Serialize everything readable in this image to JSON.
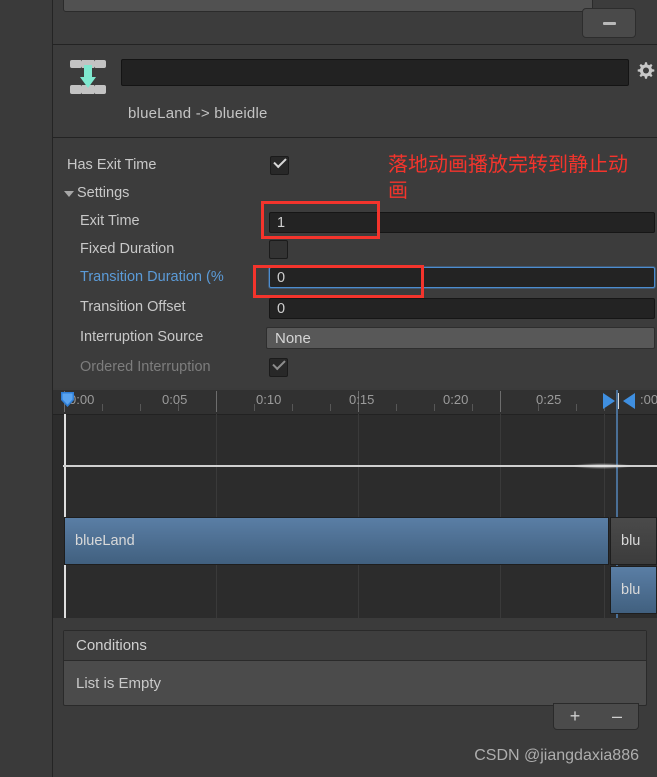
{
  "window": {
    "top_block": {
      "minus_button_label": "–"
    }
  },
  "transition": {
    "icon_name": "transition-icon",
    "name_field_value": "",
    "gear_icon_name": "gear-icon",
    "title": "blueLand -> blueidle"
  },
  "settings": {
    "has_exit_time": {
      "label": "Has Exit Time",
      "checked": true
    },
    "foldout": {
      "label": "Settings",
      "expanded": true
    },
    "fields": [
      {
        "label": "Exit Time",
        "value": "1",
        "type": "number",
        "highlighted": true
      },
      {
        "label": "Fixed Duration",
        "value": "",
        "type": "checkbox",
        "checked": false
      },
      {
        "label": "Transition Duration (%",
        "value": "0",
        "type": "number",
        "focused": true,
        "highlighted": true
      },
      {
        "label": "Transition Offset",
        "value": "0",
        "type": "number"
      },
      {
        "label": "Interruption Source",
        "value": "None",
        "type": "dropdown"
      },
      {
        "label": "Ordered Interruption",
        "value": "",
        "type": "checkbox",
        "checked": true,
        "disabled": true
      }
    ]
  },
  "annotation": {
    "text": "落地动画播放完转到静止动画",
    "color": "#f4342c"
  },
  "timeline": {
    "ruler_labels": [
      "0:00",
      "0:05",
      "0:10",
      "0:15",
      "0:20",
      "0:25",
      ":00"
    ],
    "playhead_icon": "playhead-marker-icon",
    "clips": [
      {
        "label": "blueLand",
        "row": 0
      },
      {
        "label": "blu",
        "row": 0,
        "side": "right"
      },
      {
        "label": "blu",
        "row": 1,
        "side": "right"
      }
    ]
  },
  "conditions": {
    "header": "Conditions",
    "empty_text": "List is Empty",
    "add_label": "+",
    "remove_label": "–"
  },
  "watermark": {
    "text": "CSDN @jiangdaxia886"
  }
}
